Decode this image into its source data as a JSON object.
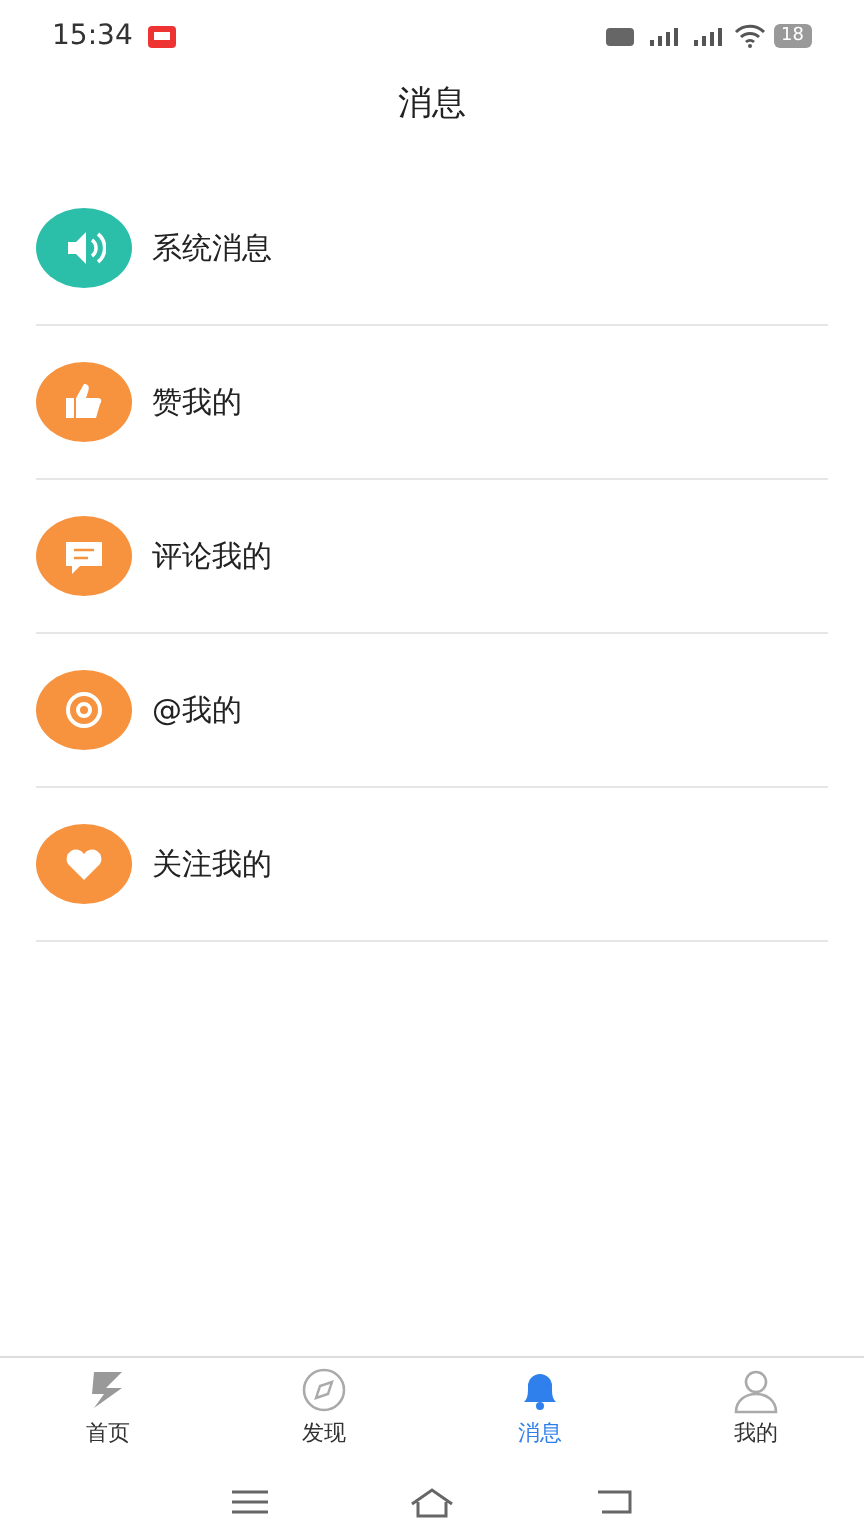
{
  "status_bar": {
    "time": "15:34",
    "battery": "18"
  },
  "title": "消息",
  "items": [
    {
      "label": "系统消息",
      "kind": "speaker",
      "color": "#2bbfaa"
    },
    {
      "label": "赞我的",
      "kind": "thumb",
      "color": "#f7923f"
    },
    {
      "label": "评论我的",
      "kind": "comment",
      "color": "#f7923f"
    },
    {
      "label": "@我的",
      "kind": "at",
      "color": "#f7923f"
    },
    {
      "label": "关注我的",
      "kind": "heart",
      "color": "#f7923f"
    }
  ],
  "tabs": [
    {
      "label": "首页",
      "kind": "home",
      "selected": false
    },
    {
      "label": "发现",
      "kind": "discover",
      "selected": false
    },
    {
      "label": "消息",
      "kind": "bell",
      "selected": true
    },
    {
      "label": "我的",
      "kind": "user",
      "selected": false
    }
  ]
}
